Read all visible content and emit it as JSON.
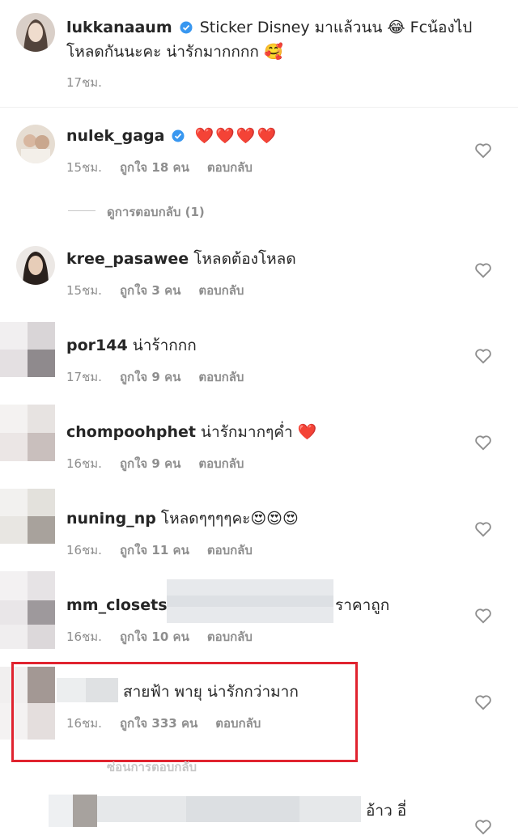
{
  "caption": {
    "username": "lukkanaaum",
    "text_line1": "Sticker Disney มาแล้วนน 😂 Fcน้องไป",
    "text_line2": "โหลดกันนะคะ น่ารักมากกกก 🥰",
    "time": "17ชม."
  },
  "comments": [
    {
      "username": "nulek_gaga",
      "text": "❤️❤️❤️❤️",
      "time": "15ชม.",
      "likes": "ถูกใจ 18 คน",
      "reply": "ตอบกลับ"
    },
    {
      "username": "kree_pasawee",
      "text": "โหลดต้องโหลด",
      "time": "15ชม.",
      "likes": "ถูกใจ 3 คน",
      "reply": "ตอบกลับ"
    },
    {
      "username": "por144",
      "text": "น่าร้ากกก",
      "time": "17ชม.",
      "likes": "ถูกใจ 9 คน",
      "reply": "ตอบกลับ"
    },
    {
      "username": "chompoohphet",
      "text": "น่ารักมากๆค่ำ ❤️",
      "time": "16ชม.",
      "likes": "ถูกใจ 9 คน",
      "reply": "ตอบกลับ"
    },
    {
      "username": "nuning_np",
      "text": "โหลดๆๆๆๆคะ😍😍😍",
      "time": "16ชม.",
      "likes": "ถูกใจ 11 คน",
      "reply": "ตอบกลับ"
    },
    {
      "username": "mm_closets",
      "text": "ราคาถูก",
      "time": "16ชม.",
      "likes": "ถูกใจ 10 คน",
      "reply": "ตอบกลับ"
    },
    {
      "username": "",
      "text": "สายฟ้า พายุ น่ารักกว่ามาก",
      "time": "16ชม.",
      "likes": "ถูกใจ 333 คน",
      "reply": "ตอบกลับ"
    },
    {
      "username": "",
      "text": "อ้าว อี่",
      "time": "",
      "likes": "",
      "reply": ""
    }
  ],
  "view_replies": "ดูการตอบกลับ (1)",
  "hidden_replies": "ซ่อนการตอบกลับ",
  "colors": {
    "verified": "#3897f0",
    "highlight": "#e0232f",
    "meta": "#8e8e8e",
    "heart_outline": "#8e8e8e"
  },
  "icons": [
    "verified-badge-icon",
    "heart-outline-icon",
    "red-heart-emoji-icon"
  ]
}
